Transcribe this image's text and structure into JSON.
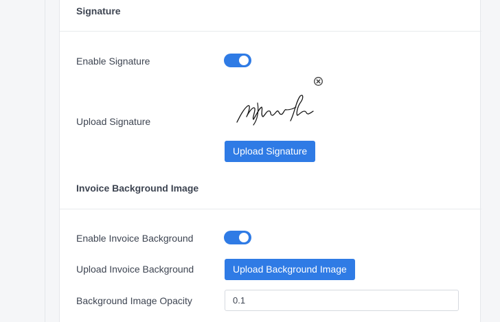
{
  "signature_section": {
    "title": "Signature",
    "enable_label": "Enable Signature",
    "enable_on": true,
    "upload_label": "Upload Signature",
    "upload_button": "Upload Signature",
    "remove_icon": "close-circle-icon"
  },
  "background_section": {
    "title": "Invoice Background Image",
    "enable_label": "Enable Invoice Background",
    "enable_on": true,
    "upload_label": "Upload Invoice Background",
    "upload_button": "Upload Background Image",
    "opacity_label": "Background Image Opacity",
    "opacity_value": "0.1"
  },
  "colors": {
    "accent": "#2f7be5",
    "text": "#3d4451",
    "divider": "#e8eaed"
  }
}
